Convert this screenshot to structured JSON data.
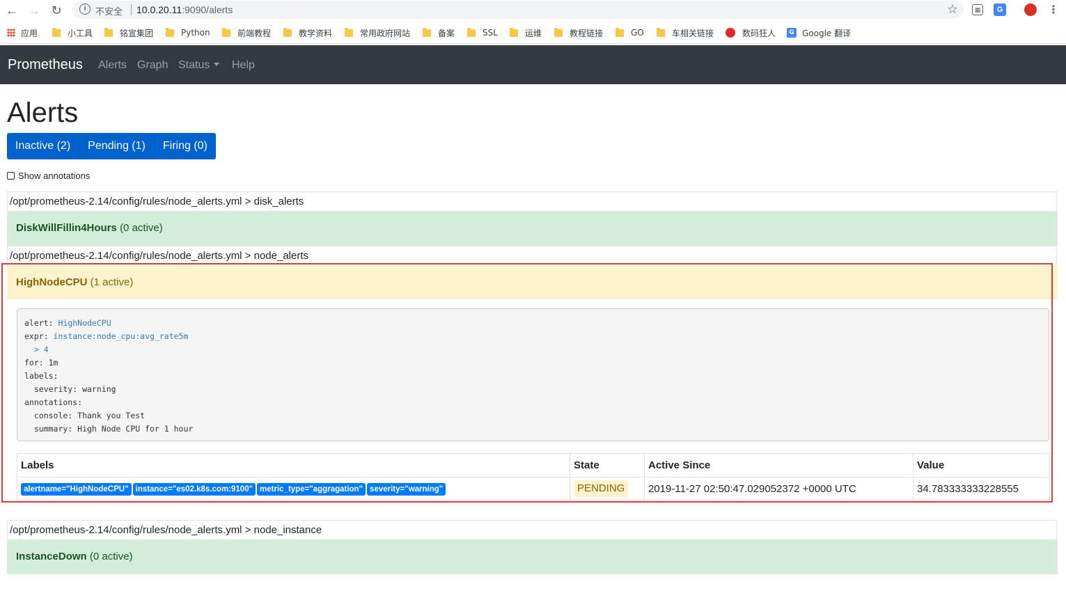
{
  "browser": {
    "security_label": "不安全",
    "url_host": "10.0.20.11",
    "url_rest": ":9090/alerts",
    "bookmarks": [
      "应用",
      "小工具",
      "铭宣集团",
      "Python",
      "前端教程",
      "教学资料",
      "常用政府网站",
      "备案",
      "SSL",
      "运维",
      "教程链接",
      "GO",
      "车相关链接",
      "数码狂人",
      "Google 翻译"
    ]
  },
  "navbar": {
    "brand": "Prometheus",
    "links": [
      "Alerts",
      "Graph",
      "Status",
      "Help"
    ]
  },
  "page": {
    "title": "Alerts",
    "tabs": [
      "Inactive (2)",
      "Pending (1)",
      "Firing (0)"
    ],
    "show_annotations": "Show annotations"
  },
  "groups": [
    {
      "path": "/opt/prometheus-2.14/config/rules/node_alerts.yml > disk_alerts",
      "rule_name": "DiskWillFillin4Hours",
      "rule_count": "(0 active)"
    },
    {
      "path": "/opt/prometheus-2.14/config/rules/node_alerts.yml > node_alerts",
      "rule_name": "HighNodeCPU",
      "rule_count": "(1 active)"
    },
    {
      "path": "/opt/prometheus-2.14/config/rules/node_alerts.yml > node_instance",
      "rule_name": "InstanceDown",
      "rule_count": "(0 active)"
    }
  ],
  "rule_detail": {
    "alert_key": "alert: ",
    "alert_val": "HighNodeCPU",
    "expr_key": "expr: ",
    "expr_val": "instance:node_cpu:avg_rate5m",
    "expr_cont": "  > 4",
    "for": "for: 1m",
    "labels_key": "labels:",
    "severity": "  severity: warning",
    "annotations_key": "annotations:",
    "console": "  console: Thank you Test",
    "summary": "  summary: High Node CPU for 1 hour"
  },
  "alerts_table": {
    "headers": [
      "Labels",
      "State",
      "Active Since",
      "Value"
    ],
    "row": {
      "labels": [
        "alertname=\"HighNodeCPU\"",
        "instance=\"es02.k8s.com:9100\"",
        "metric_type=\"aggragation\"",
        "severity=\"warning\""
      ],
      "state": "PENDING",
      "active_since": "2019-11-27 02:50:47.029052372 +0000 UTC",
      "value": "34.783333333228555"
    }
  }
}
